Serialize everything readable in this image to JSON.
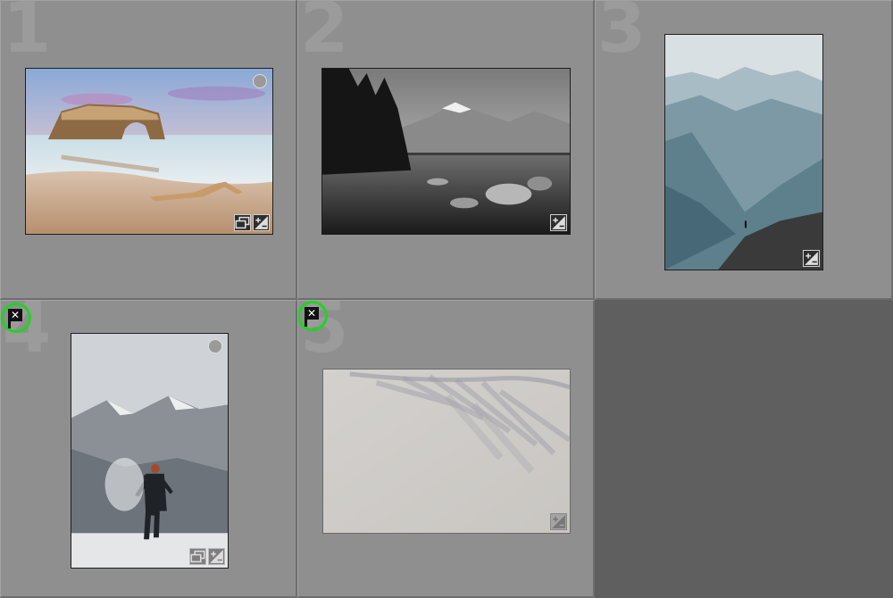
{
  "cells": [
    {
      "number": "1",
      "has_circle": true,
      "badges": [
        "stack-icon",
        "adjust-icon"
      ],
      "flag": ""
    },
    {
      "number": "2",
      "has_circle": false,
      "badges": [
        "adjust-icon"
      ],
      "flag": ""
    },
    {
      "number": "3",
      "has_circle": false,
      "badges": [
        "adjust-icon"
      ],
      "flag": ""
    },
    {
      "number": "4",
      "has_circle": true,
      "badges": [
        "stack-icon",
        "adjust-icon"
      ],
      "flag": "rejected"
    },
    {
      "number": "5",
      "has_circle": false,
      "badges": [
        "adjust-icon"
      ],
      "flag": "rejected"
    }
  ],
  "flag_glyph": "✕",
  "colors": {
    "highlight_ring": "#1fd41f",
    "cell_bg": "#8f8f8f",
    "empty_bg": "#5f5f5f"
  }
}
